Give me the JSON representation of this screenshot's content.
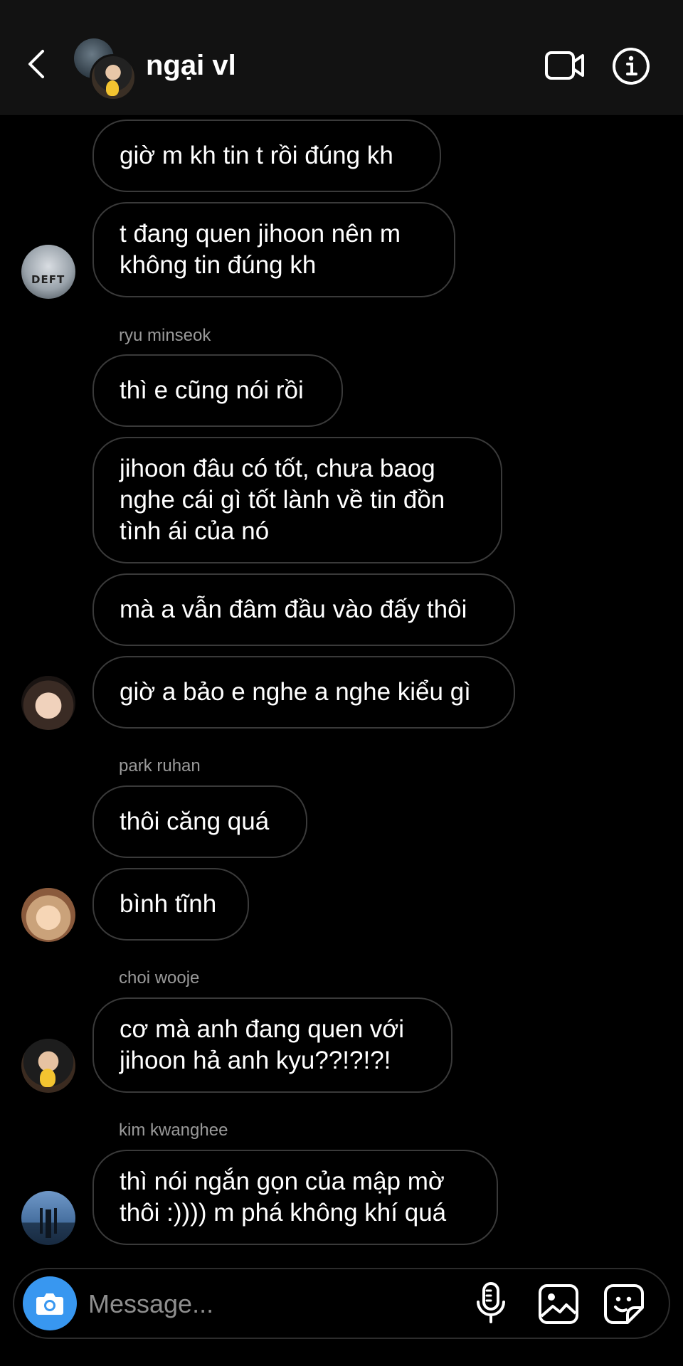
{
  "header": {
    "title": "ngại vl",
    "icons": {
      "back": "chevron-left-icon",
      "video": "video-call-icon",
      "info": "info-icon"
    }
  },
  "messages": [
    {
      "text": "giờ m kh tin t rồi đúng kh"
    },
    {
      "text": "t đang quen jihoon nên m\nkhông tin đúng kh",
      "avatar": "deft"
    },
    {
      "sender": "ryu minseok"
    },
    {
      "text": "thì e cũng nói rồi"
    },
    {
      "text": "jihoon đâu có tốt, chưa baog\nnghe cái gì tốt lành về tin đồn\ntình ái của nó"
    },
    {
      "text": "mà a vẫn đâm đầu vào đấy thôi"
    },
    {
      "text": "giờ a bảo e nghe a nghe kiểu gì",
      "avatar": "face"
    },
    {
      "sender": "park ruhan"
    },
    {
      "text": "thôi căng quá"
    },
    {
      "text": "bình tĩnh",
      "avatar": "face"
    },
    {
      "sender": "choi wooje"
    },
    {
      "text": "cơ mà anh đang quen với\njihoon hả anh kyu??!?!?!",
      "avatar": "face"
    },
    {
      "sender": "kim kwanghee"
    },
    {
      "text": "thì nói ngắn gọn của mập mờ\nthôi :)))) m phá không khí quá",
      "avatar": "landscape"
    }
  ],
  "avatars": {
    "deft_cap_text": "DEFT"
  },
  "composer": {
    "placeholder": "Message...",
    "icons": {
      "camera": "camera-icon",
      "mic": "microphone-icon",
      "gallery": "image-icon",
      "sticker": "sticker-icon"
    }
  },
  "colors": {
    "background": "#000000",
    "header": "#121212",
    "bubble_border": "#3a3a3a",
    "camera_button": "#3897f0",
    "sender_name": "#9a9a9a"
  }
}
